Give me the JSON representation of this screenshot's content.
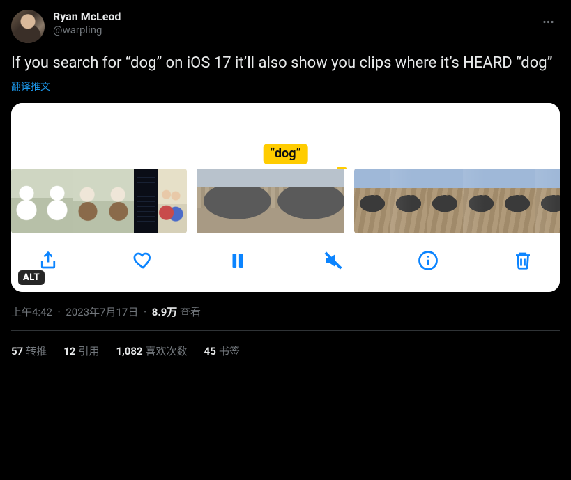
{
  "author": {
    "display_name": "Ryan McLeod",
    "handle": "@warpling"
  },
  "tweet_text": "If you search for “dog” on iOS 17 it’ll also show you clips where it’s HEARD “dog”",
  "translate_label": "翻译推文",
  "media": {
    "caption_label": "“dog”",
    "alt_badge": "ALT",
    "toolbar_icons": {
      "share": "share-icon",
      "like": "heart-icon",
      "pause": "pause-icon",
      "mute": "mute-icon",
      "info": "info-icon",
      "trash": "trash-icon"
    }
  },
  "meta": {
    "time": "上午4:42",
    "date": "2023年7月17日",
    "views_num": "8.9万",
    "views_label": "查看",
    "separator": "·"
  },
  "stats": {
    "retweets": {
      "count": "57",
      "label": "转推"
    },
    "quotes": {
      "count": "12",
      "label": "引用"
    },
    "likes": {
      "count": "1,082",
      "label": "喜欢次数"
    },
    "bookmarks": {
      "count": "45",
      "label": "书签"
    }
  }
}
